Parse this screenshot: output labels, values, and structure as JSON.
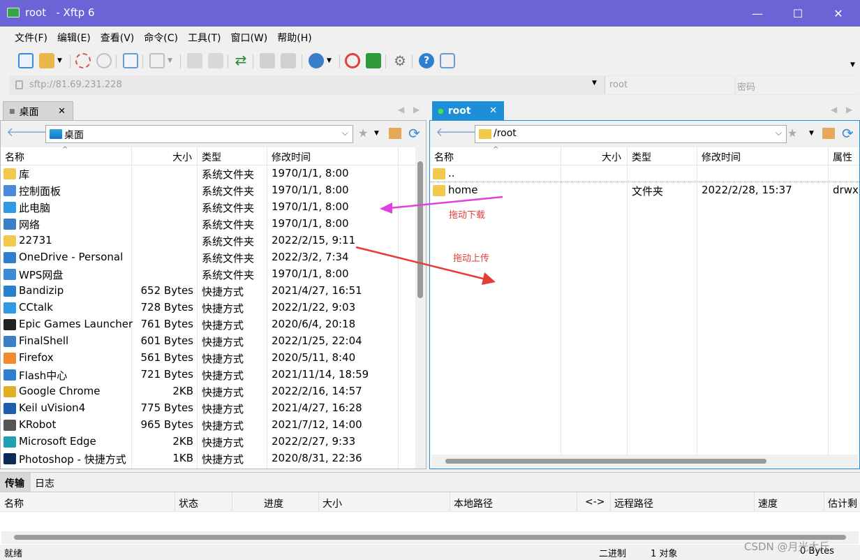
{
  "window": {
    "title": "root   - Xftp 6",
    "minimize": "—",
    "maximize": "☐",
    "close": "✕"
  },
  "menu": [
    "文件(F)",
    "编辑(E)",
    "查看(V)",
    "命令(C)",
    "工具(T)",
    "窗口(W)",
    "帮助(H)"
  ],
  "address": {
    "url": "sftp://81.69.231.228",
    "user_placeholder": "root",
    "password_placeholder": "密码"
  },
  "left": {
    "tab": "桌面",
    "path": "桌面",
    "headers": {
      "name": "名称",
      "size": "大小",
      "type": "类型",
      "modified": "修改时间"
    },
    "rows": [
      {
        "name": "库",
        "size": "",
        "type": "系统文件夹",
        "date": "1970/1/1, 8:00",
        "icon": "library-folder-icon"
      },
      {
        "name": "控制面板",
        "size": "",
        "type": "系统文件夹",
        "date": "1970/1/1, 8:00",
        "icon": "control-panel-icon"
      },
      {
        "name": "此电脑",
        "size": "",
        "type": "系统文件夹",
        "date": "1970/1/1, 8:00",
        "icon": "computer-icon"
      },
      {
        "name": "网络",
        "size": "",
        "type": "系统文件夹",
        "date": "1970/1/1, 8:00",
        "icon": "network-icon"
      },
      {
        "name": "22731",
        "size": "",
        "type": "系统文件夹",
        "date": "2022/2/15, 9:11",
        "icon": "user-folder-icon"
      },
      {
        "name": "OneDrive - Personal",
        "size": "",
        "type": "系统文件夹",
        "date": "2022/3/2, 7:34",
        "icon": "onedrive-icon"
      },
      {
        "name": "WPS网盘",
        "size": "",
        "type": "系统文件夹",
        "date": "1970/1/1, 8:00",
        "icon": "wps-cloud-icon"
      },
      {
        "name": "Bandizip",
        "size": "652 Bytes",
        "type": "快捷方式",
        "date": "2021/4/27, 16:51",
        "icon": "bandizip-icon"
      },
      {
        "name": "CCtalk",
        "size": "728 Bytes",
        "type": "快捷方式",
        "date": "2022/1/22, 9:03",
        "icon": "cctalk-icon"
      },
      {
        "name": "Epic Games Launcher",
        "size": "761 Bytes",
        "type": "快捷方式",
        "date": "2020/6/4, 20:18",
        "icon": "epic-games-icon"
      },
      {
        "name": "FinalShell",
        "size": "601 Bytes",
        "type": "快捷方式",
        "date": "2022/1/25, 22:04",
        "icon": "finalshell-icon"
      },
      {
        "name": "Firefox",
        "size": "561 Bytes",
        "type": "快捷方式",
        "date": "2020/5/11, 8:40",
        "icon": "firefox-icon"
      },
      {
        "name": "Flash中心",
        "size": "721 Bytes",
        "type": "快捷方式",
        "date": "2021/11/14, 18:59",
        "icon": "flash-icon"
      },
      {
        "name": "Google Chrome",
        "size": "2KB",
        "type": "快捷方式",
        "date": "2022/2/16, 14:57",
        "icon": "chrome-icon"
      },
      {
        "name": "Keil uVision4",
        "size": "775 Bytes",
        "type": "快捷方式",
        "date": "2021/4/27, 16:28",
        "icon": "keil-icon"
      },
      {
        "name": "KRobot",
        "size": "965 Bytes",
        "type": "快捷方式",
        "date": "2021/7/12, 14:00",
        "icon": "krobot-icon"
      },
      {
        "name": "Microsoft Edge",
        "size": "2KB",
        "type": "快捷方式",
        "date": "2022/2/27, 9:33",
        "icon": "edge-icon"
      },
      {
        "name": "Photoshop - 快捷方式",
        "size": "1KB",
        "type": "快捷方式",
        "date": "2020/8/31, 22:36",
        "icon": "photoshop-icon"
      }
    ]
  },
  "right": {
    "tab": "root",
    "path": "/root",
    "headers": {
      "name": "名称",
      "size": "大小",
      "type": "类型",
      "modified": "修改时间",
      "attr": "属性"
    },
    "rows": [
      {
        "name": "..",
        "size": "",
        "type": "",
        "date": "",
        "attr": ""
      },
      {
        "name": "home",
        "size": "",
        "type": "文件夹",
        "date": "2022/2/28, 15:37",
        "attr": "drwxr"
      }
    ]
  },
  "annotations": {
    "download": "拖动下载",
    "upload": "拖动上传"
  },
  "bottom": {
    "tabs": [
      "传输",
      "日志"
    ],
    "headers": [
      "名称",
      "状态",
      "进度",
      "大小",
      "本地路径",
      "<->",
      "远程路径",
      "速度",
      "估计剩"
    ]
  },
  "status": {
    "ready": "就绪",
    "mode": "二进制",
    "objects": "1 对象",
    "bytes": "0 Bytes",
    "watermark": "CSDN @月光太斤"
  },
  "colors": {
    "titlebar": "#6b63d6",
    "active_tab": "#1c8fd8",
    "arrow_download": "#e040e0",
    "arrow_upload": "#e53b3b"
  }
}
